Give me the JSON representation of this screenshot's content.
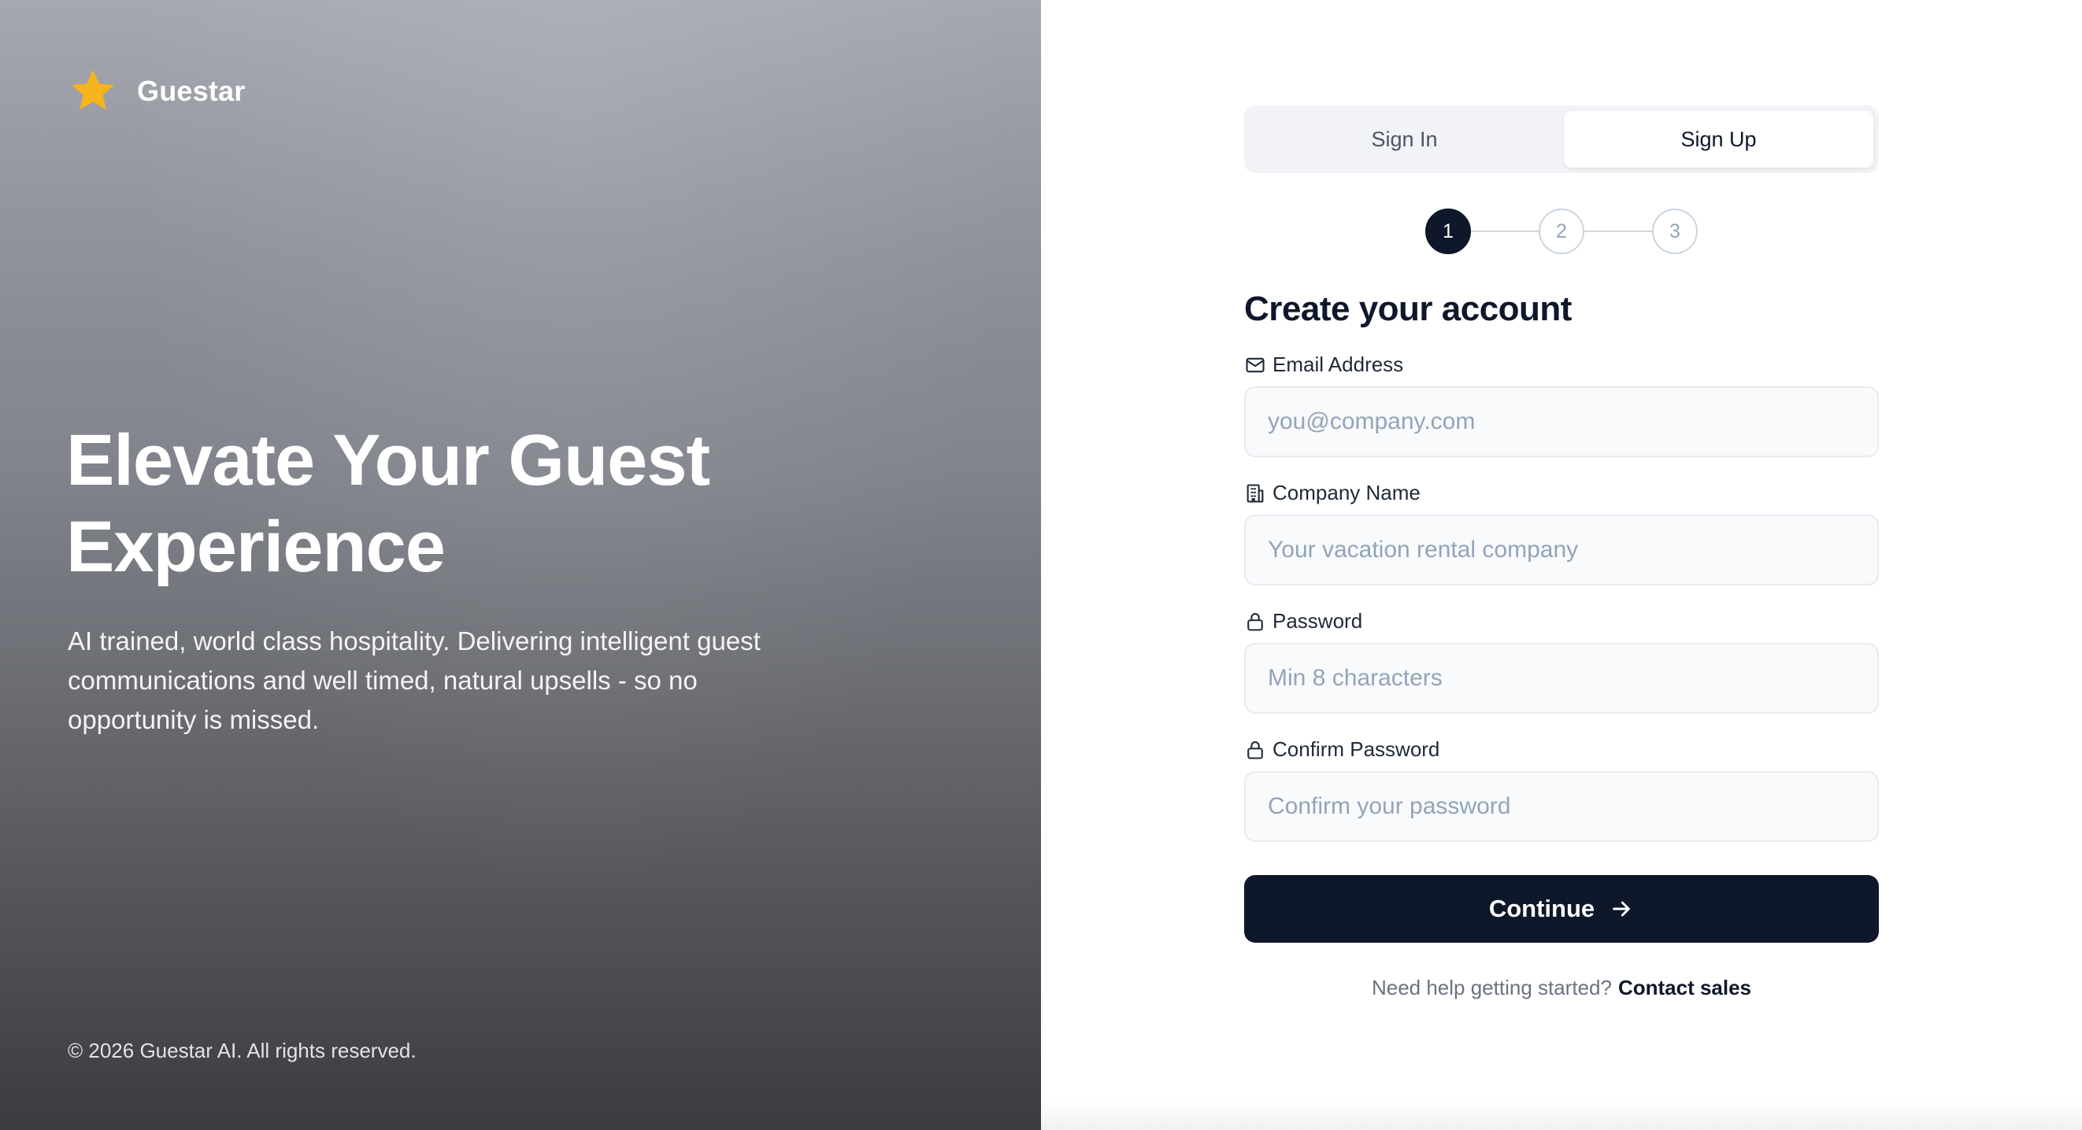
{
  "brand": {
    "name": "Guestar",
    "icon": "star-icon",
    "accent": "#F5B41E"
  },
  "hero": {
    "headline": "Elevate Your Guest Experience",
    "tagline": "AI trained, world class hospitality. Delivering intelligent guest communications and well timed, natural upsells - so no opportunity is missed.",
    "copyright": "© 2026 Guestar AI. All rights reserved."
  },
  "tabs": [
    {
      "label": "Sign In",
      "active": false
    },
    {
      "label": "Sign Up",
      "active": true
    }
  ],
  "stepper": {
    "steps": [
      "1",
      "2",
      "3"
    ],
    "current": 1
  },
  "form": {
    "title": "Create your account",
    "fields": [
      {
        "label": "Email Address",
        "placeholder": "you@company.com",
        "icon": "mail-icon",
        "value": ""
      },
      {
        "label": "Company Name",
        "placeholder": "Your vacation rental company",
        "icon": "building-icon",
        "value": ""
      },
      {
        "label": "Password",
        "placeholder": "Min 8 characters",
        "icon": "lock-icon",
        "value": ""
      },
      {
        "label": "Confirm Password",
        "placeholder": "Confirm your password",
        "icon": "lock-icon",
        "value": ""
      }
    ],
    "continue_label": "Continue",
    "help_text": "Need help getting started?",
    "help_link": "Contact sales"
  },
  "colors": {
    "primary": "#0F172A",
    "tab_bg": "#F1F3F6",
    "input_bg": "#F8FAFC"
  }
}
